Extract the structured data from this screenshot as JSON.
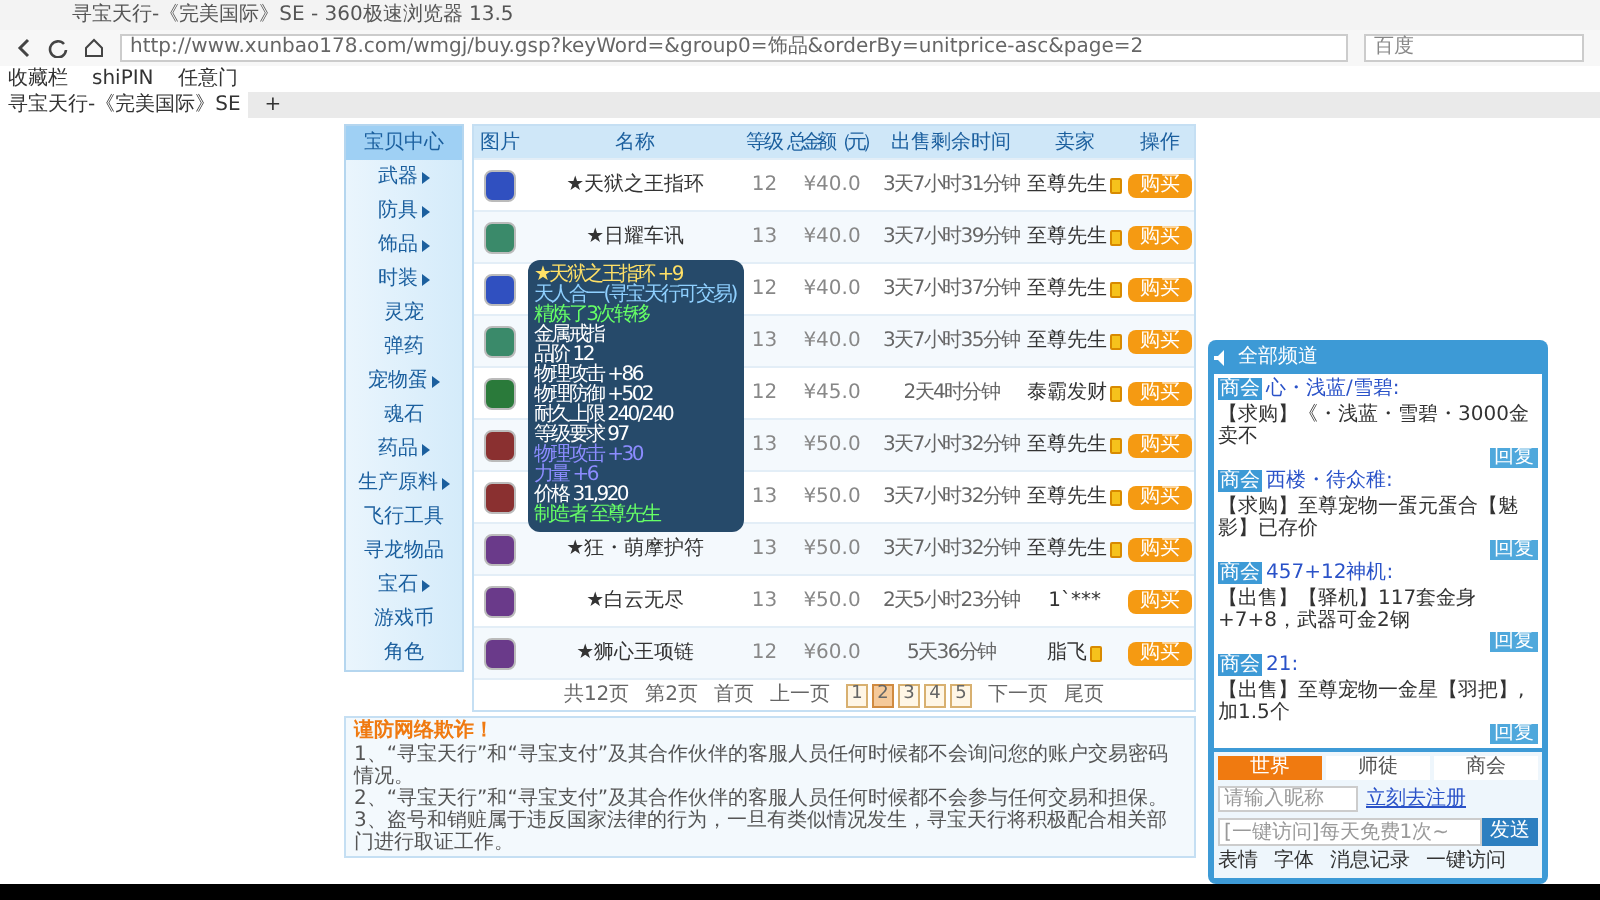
{
  "browser": {
    "title": "寻宝天行-《完美国际》SE - 360极速浏览器 13.5",
    "url": "http://www.xunbao178.com/wmgj/buy.gsp?keyWord=&group0=饰品&orderBy=unitprice-asc&page=2",
    "search_placeholder": "百度",
    "bookmarks": [
      "收藏栏",
      "shiPIN",
      "任意门"
    ],
    "tabs": [
      {
        "label": "寻宝天行-《完美国际》SE",
        "selected": true
      }
    ],
    "new_tab": "+"
  },
  "sidebar": {
    "items": [
      {
        "label": "宝贝中心",
        "selected": true,
        "submenu": false
      },
      {
        "label": "武器",
        "selected": false,
        "submenu": true
      },
      {
        "label": "防具",
        "selected": false,
        "submenu": true
      },
      {
        "label": "饰品",
        "selected": false,
        "submenu": true
      },
      {
        "label": "时装",
        "selected": false,
        "submenu": true
      },
      {
        "label": "灵宠",
        "selected": false,
        "submenu": false
      },
      {
        "label": "弹药",
        "selected": false,
        "submenu": false
      },
      {
        "label": "宠物蛋",
        "selected": false,
        "submenu": true
      },
      {
        "label": "魂石",
        "selected": false,
        "submenu": false
      },
      {
        "label": "药品",
        "selected": false,
        "submenu": true
      },
      {
        "label": "生产原料",
        "selected": false,
        "submenu": true
      },
      {
        "label": "飞行工具",
        "selected": false,
        "submenu": false
      },
      {
        "label": "寻龙物品",
        "selected": false,
        "submenu": false
      },
      {
        "label": "宝石",
        "selected": false,
        "submenu": true
      },
      {
        "label": "游戏币",
        "selected": false,
        "submenu": false
      },
      {
        "label": "角色",
        "selected": false,
        "submenu": false
      }
    ]
  },
  "table": {
    "columns": [
      "图片",
      "名称",
      "等级",
      "总金额（元）",
      "出售剩余时间",
      "卖家",
      "操作"
    ],
    "rows": [
      {
        "name": "★天狱之王指环",
        "level": "12",
        "price": "¥40.0",
        "time_left": "3天7小时31分钟",
        "seller": "至尊先生",
        "seller_badge": true,
        "action": "购买"
      },
      {
        "name": "★日耀车讯",
        "level": "13",
        "price": "¥40.0",
        "time_left": "3天7小时39分钟",
        "seller": "至尊先生",
        "seller_badge": true,
        "action": "购买"
      },
      {
        "level": "12",
        "price": "¥40.0",
        "time_left": "3天7小时37分钟",
        "seller": "至尊先生",
        "seller_badge": true,
        "action": "购买"
      },
      {
        "level": "13",
        "price": "¥40.0",
        "time_left": "3天7小时35分钟",
        "seller": "至尊先生",
        "seller_badge": true,
        "action": "购买"
      },
      {
        "level": "12",
        "price": "¥45.0",
        "time_left": "2天4时分钟",
        "seller": "泰霸发财",
        "seller_badge": true,
        "action": "购买"
      },
      {
        "level": "13",
        "price": "¥50.0",
        "time_left": "3天7小时32分钟",
        "seller": "至尊先生",
        "seller_badge": true,
        "action": "购买"
      },
      {
        "level": "13",
        "price": "¥50.0",
        "time_left": "3天7小时32分钟",
        "seller": "至尊先生",
        "seller_badge": true,
        "action": "购买"
      },
      {
        "name": "★狂・萌摩护符",
        "level": "13",
        "price": "¥50.0",
        "time_left": "3天7小时32分钟",
        "seller": "至尊先生",
        "seller_badge": true,
        "action": "购买"
      },
      {
        "name": "★白云无尽",
        "level": "13",
        "price": "¥50.0",
        "time_left": "2天5小时23分钟",
        "seller": "1`***",
        "seller_badge": false,
        "action": "购买"
      },
      {
        "name": "★狮心王项链",
        "level": "12",
        "price": "¥60.0",
        "time_left": "5天36分钟",
        "seller": "脂飞",
        "seller_badge": true,
        "action": "购买"
      }
    ]
  },
  "tooltip": {
    "lines": [
      {
        "text": "★天狱之王指环 +9",
        "kind": "title"
      },
      {
        "text": "天人合一(寻宝天行可交易)",
        "kind": "bound"
      },
      {
        "text": "精炼了3次转移",
        "kind": "refine"
      },
      {
        "text": "金属戒指",
        "kind": "stat"
      },
      {
        "text": "品阶 12",
        "kind": "stat"
      },
      {
        "text": "物理攻击 +86",
        "kind": "stat"
      },
      {
        "text": "物理防御 +502",
        "kind": "stat"
      },
      {
        "text": "耐久上限 240/240",
        "kind": "stat"
      },
      {
        "text": "等级要求 97",
        "kind": "stat"
      },
      {
        "text": "物理攻击 +30",
        "kind": "bonus"
      },
      {
        "text": "力量 +6",
        "kind": "bonus"
      },
      {
        "text": "价格 31,920",
        "kind": "stat"
      },
      {
        "text": "制造者 至尊先生",
        "kind": "maker"
      }
    ]
  },
  "pagination": {
    "total": "共12页",
    "current": "第2页",
    "first": "首页",
    "prev": "上一页",
    "pages": [
      {
        "label": "1",
        "selected": false
      },
      {
        "label": "2",
        "selected": true
      },
      {
        "label": "3",
        "selected": false
      },
      {
        "label": "4",
        "selected": false
      },
      {
        "label": "5",
        "selected": false
      }
    ],
    "next": "下一页",
    "last": "尾页"
  },
  "notice": {
    "title": "谨防网络欺诈！",
    "lines": [
      "1、“寻宝天行”和“寻宝支付”及其合作伙伴的客服人员任何时候都不会询问您的账户交易密码情况。",
      "2、“寻宝天行”和“寻宝支付”及其合作伙伴的客服人员任何时候都不会参与任何交易和担保。",
      "3、盗号和销赃属于违反国家法律的行为，一旦有类似情况发生，寻宝天行将积极配合相关部门进行取证工作。"
    ]
  },
  "chat": {
    "title": "全部频道",
    "messages": [
      {
        "tag": "商会",
        "sender": "心・浅蓝/雪碧:",
        "text": "【求购】《・浅蓝・雪碧・3000金卖不",
        "reply": "回复"
      },
      {
        "tag": "商会",
        "sender": "西楼・待众稚:",
        "text": "【求购】至尊宠物一蛋元蛋合【魅影】已存价",
        "reply": "回复"
      },
      {
        "tag": "商会",
        "sender": "457+12神机:",
        "text": "【出售】【驿机】117套金身+7+8，武器可金2钢",
        "reply": "回复"
      },
      {
        "tag": "商会",
        "sender": "21:",
        "text": "【出售】至尊宠物一金星【羽把】,加1.5个",
        "reply": "回复"
      }
    ],
    "tabs": [
      {
        "label": "世界",
        "selected": true
      },
      {
        "label": "师徒",
        "selected": false
      },
      {
        "label": "商会",
        "selected": false
      }
    ],
    "nickname_placeholder": "请输入昵称",
    "register_link": "立刻去注册",
    "message_placeholder": "[一键访问]每天免费1次~",
    "send": "发送",
    "tools": [
      "表情",
      "字体",
      "消息记录",
      "一键访问"
    ]
  }
}
